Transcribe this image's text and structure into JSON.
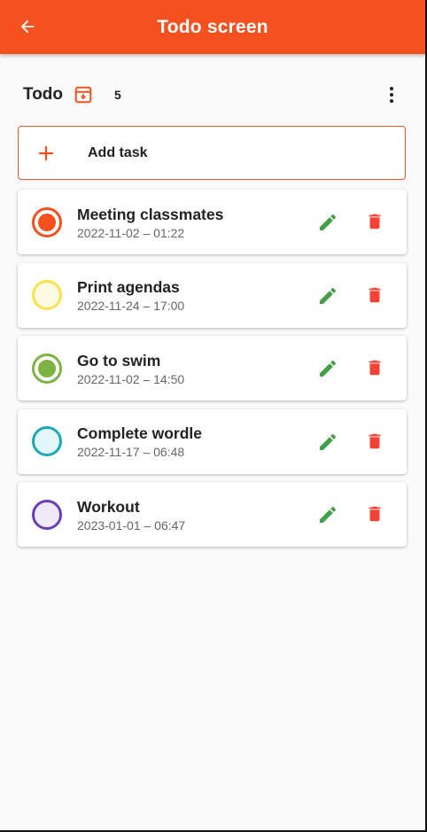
{
  "appbar": {
    "title": "Todo screen",
    "back_icon": "arrow-left-icon",
    "color": "#f5511e"
  },
  "section": {
    "title": "Todo",
    "count": "5",
    "archive_icon": "archive-icon",
    "menu_icon": "more-vert-icon"
  },
  "add_task": {
    "label": "Add task",
    "icon": "plus-icon"
  },
  "tasks": [
    {
      "title": "Meeting classmates",
      "date": "2022-11-02 – 01:22",
      "ring": "#f5511e",
      "fill": "#f5511e",
      "done": true
    },
    {
      "title": "Print agendas",
      "date": "2022-11-24 – 17:00",
      "ring": "#fbe24a",
      "fill": "#fffbe3",
      "done": false
    },
    {
      "title": "Go to swim",
      "date": "2022-11-02 – 14:50",
      "ring": "#7cb342",
      "fill": "#7cb342",
      "done": true
    },
    {
      "title": "Complete wordle",
      "date": "2022-11-17 – 06:48",
      "ring": "#1ba9b8",
      "fill": "#e3f6f8",
      "done": false
    },
    {
      "title": "Workout",
      "date": "2023-01-01 – 06:47",
      "ring": "#6a3fb5",
      "fill": "#efeaf8",
      "done": false
    }
  ],
  "icons": {
    "edit": "pencil-icon",
    "delete": "trash-icon",
    "edit_color": "#43a047",
    "delete_color": "#f44336"
  }
}
